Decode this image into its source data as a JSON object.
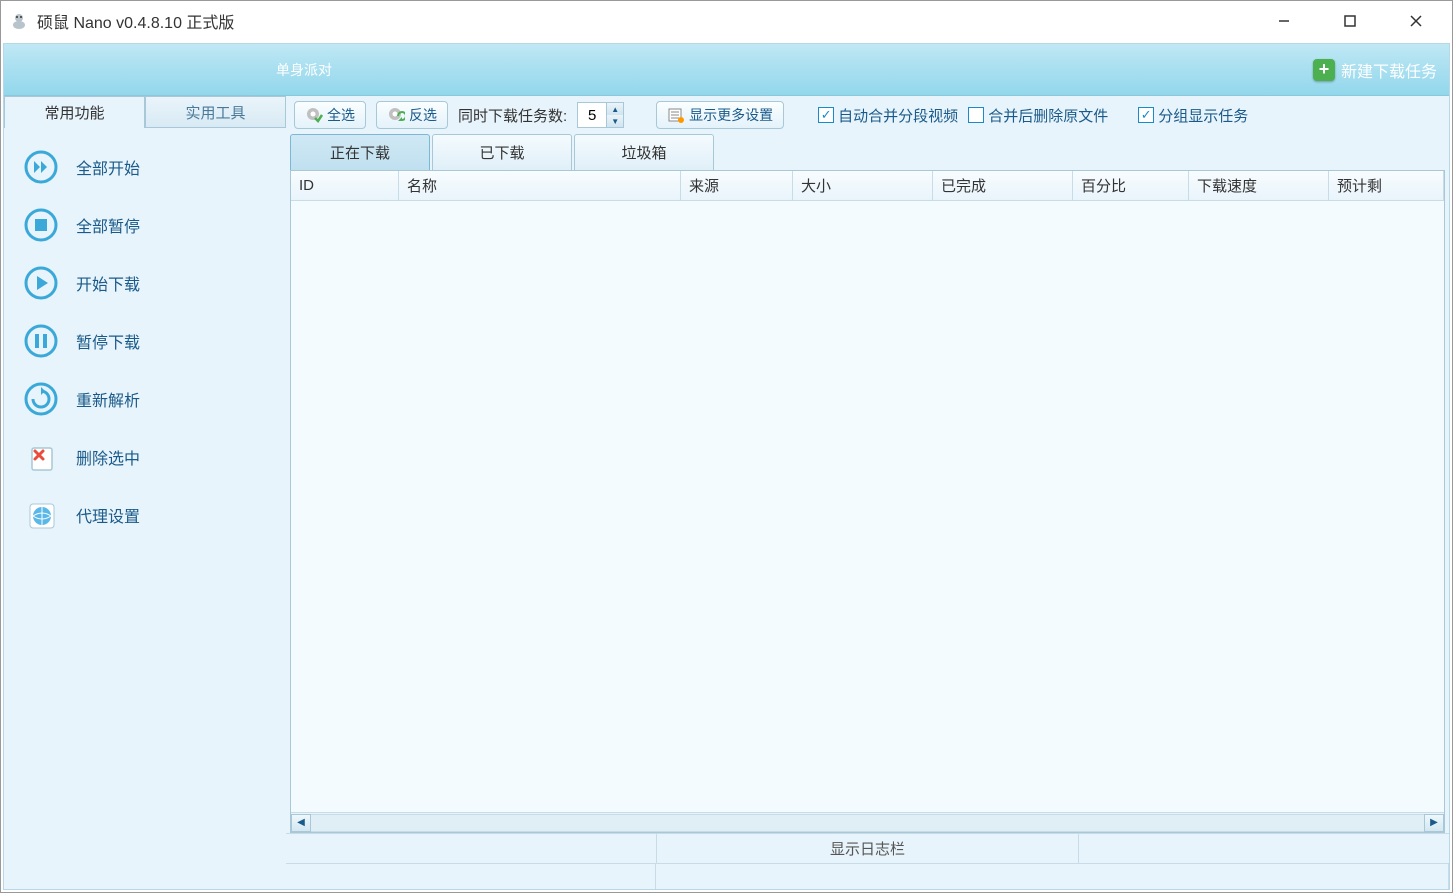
{
  "window": {
    "title": "硕鼠 Nano v0.4.8.10 正式版"
  },
  "banner": {
    "text": "单身派对",
    "new_task": "新建下载任务"
  },
  "side_tabs": {
    "common": "常用功能",
    "tools": "实用工具"
  },
  "sidebar": {
    "items": [
      {
        "label": "全部开始"
      },
      {
        "label": "全部暂停"
      },
      {
        "label": "开始下载"
      },
      {
        "label": "暂停下载"
      },
      {
        "label": "重新解析"
      },
      {
        "label": "删除选中"
      },
      {
        "label": "代理设置"
      }
    ]
  },
  "toolbar": {
    "select_all": "全选",
    "invert": "反选",
    "concurrent_label": "同时下载任务数:",
    "concurrent_value": "5",
    "more_settings": "显示更多设置",
    "auto_merge": "自动合并分段视频",
    "delete_after_merge": "合并后删除原文件",
    "group_display": "分组显示任务"
  },
  "content_tabs": {
    "downloading": "正在下载",
    "downloaded": "已下载",
    "trash": "垃圾箱"
  },
  "columns": {
    "id": "ID",
    "name": "名称",
    "source": "来源",
    "size": "大小",
    "completed": "已完成",
    "percent": "百分比",
    "speed": "下载速度",
    "eta": "预计剩"
  },
  "statusbar": {
    "log": "显示日志栏"
  }
}
